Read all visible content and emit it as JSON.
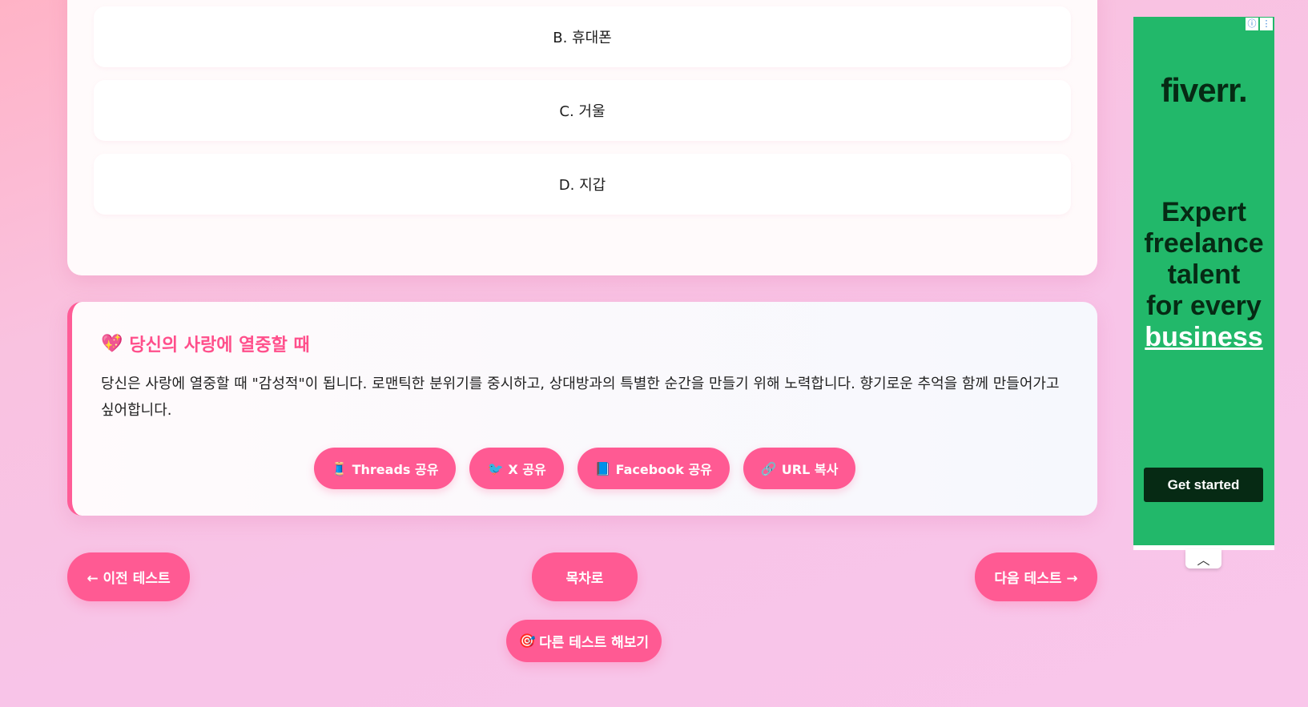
{
  "quiz": {
    "options": [
      {
        "label": "B. 휴대폰"
      },
      {
        "label": "C. 거울"
      },
      {
        "label": "D. 지갑"
      }
    ]
  },
  "result": {
    "title_emoji": "💖",
    "title": "당신의 사랑에 열중할 때",
    "description": "당신은 사랑에 열중할 때 \"감성적\"이 됩니다. 로맨틱한 분위기를 중시하고, 상대방과의 특별한 순간을 만들기 위해 노력합니다. 향기로운 추억을 함께 만들어가고 싶어합니다.",
    "share": {
      "threads": {
        "icon": "🧵",
        "label": "Threads 공유"
      },
      "x": {
        "icon": "🐦",
        "label": "X 공유"
      },
      "facebook": {
        "icon": "📘",
        "label": "Facebook 공유"
      },
      "url": {
        "icon": "🔗",
        "label": "URL 복사"
      }
    }
  },
  "nav": {
    "prev": "← 이전 테스트",
    "toc": "목차로",
    "next": "다음 테스트 →",
    "other_icon": "🎯",
    "other": "다른 테스트 해보기"
  },
  "ad": {
    "info_icon": "ⓘ",
    "menu_icon": "⋮",
    "brand": "fiverr.",
    "headline_lines": [
      "Expert",
      "freelance",
      "talent",
      "for every"
    ],
    "headline_emphasis": "business",
    "cta": "Get started",
    "collapse_icon": "︿",
    "brand_color": "#22b86a"
  },
  "colors": {
    "accent": "#ff5a93",
    "title_pink": "#ff4f8b"
  }
}
